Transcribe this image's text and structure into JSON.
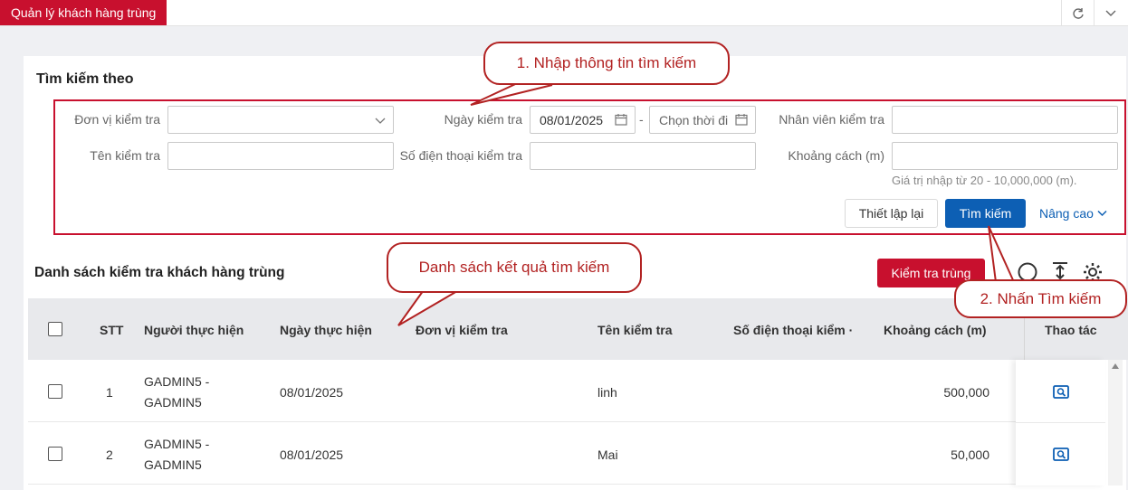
{
  "tab": {
    "title": "Quản lý khách hàng trùng"
  },
  "search": {
    "title": "Tìm kiếm theo",
    "fields": {
      "unit_label": "Đơn vị kiểm tra",
      "date_label": "Ngày kiểm tra",
      "date_from": "08/01/2025",
      "date_sep": "-",
      "date_to_placeholder": "Chọn thời đi",
      "staff_label": "Nhân viên kiểm tra",
      "name_label": "Tên kiểm tra",
      "phone_label": "Số điện thoại kiểm tra",
      "distance_label": "Khoảng cách (m)",
      "distance_hint": "Giá trị nhập từ 20 - 10,000,000 (m)."
    },
    "buttons": {
      "reset": "Thiết lập lại",
      "search": "Tìm kiếm",
      "advanced": "Nâng cao"
    }
  },
  "list": {
    "title": "Danh sách kiểm tra khách hàng trùng",
    "check_button": "Kiểm tra trùng",
    "columns": [
      "STT",
      "Người thực hiện",
      "Ngày thực hiện",
      "Đơn vị kiểm tra",
      "Tên kiểm tra",
      "Số điện thoại kiểm ·",
      "Khoảng cách (m)",
      "Thao tác"
    ],
    "rows": [
      {
        "stt": "1",
        "performer_1": "GADMIN5 -",
        "performer_2": "GADMIN5",
        "date": "08/01/2025",
        "unit": "",
        "name": "linh",
        "phone": "",
        "distance": "500,000"
      },
      {
        "stt": "2",
        "performer_1": "GADMIN5 -",
        "performer_2": "GADMIN5",
        "date": "08/01/2025",
        "unit": "",
        "name": "Mai",
        "phone": "",
        "distance": "50,000"
      }
    ]
  },
  "callouts": {
    "step1": "1. Nhập thông tin tìm kiếm",
    "result": "Danh sách kết quả tìm kiếm",
    "step2": "2. Nhấn Tìm kiếm"
  },
  "colors": {
    "brand_red": "#c8102e",
    "primary_blue": "#0d5fb4",
    "callout_red": "#b22222"
  }
}
